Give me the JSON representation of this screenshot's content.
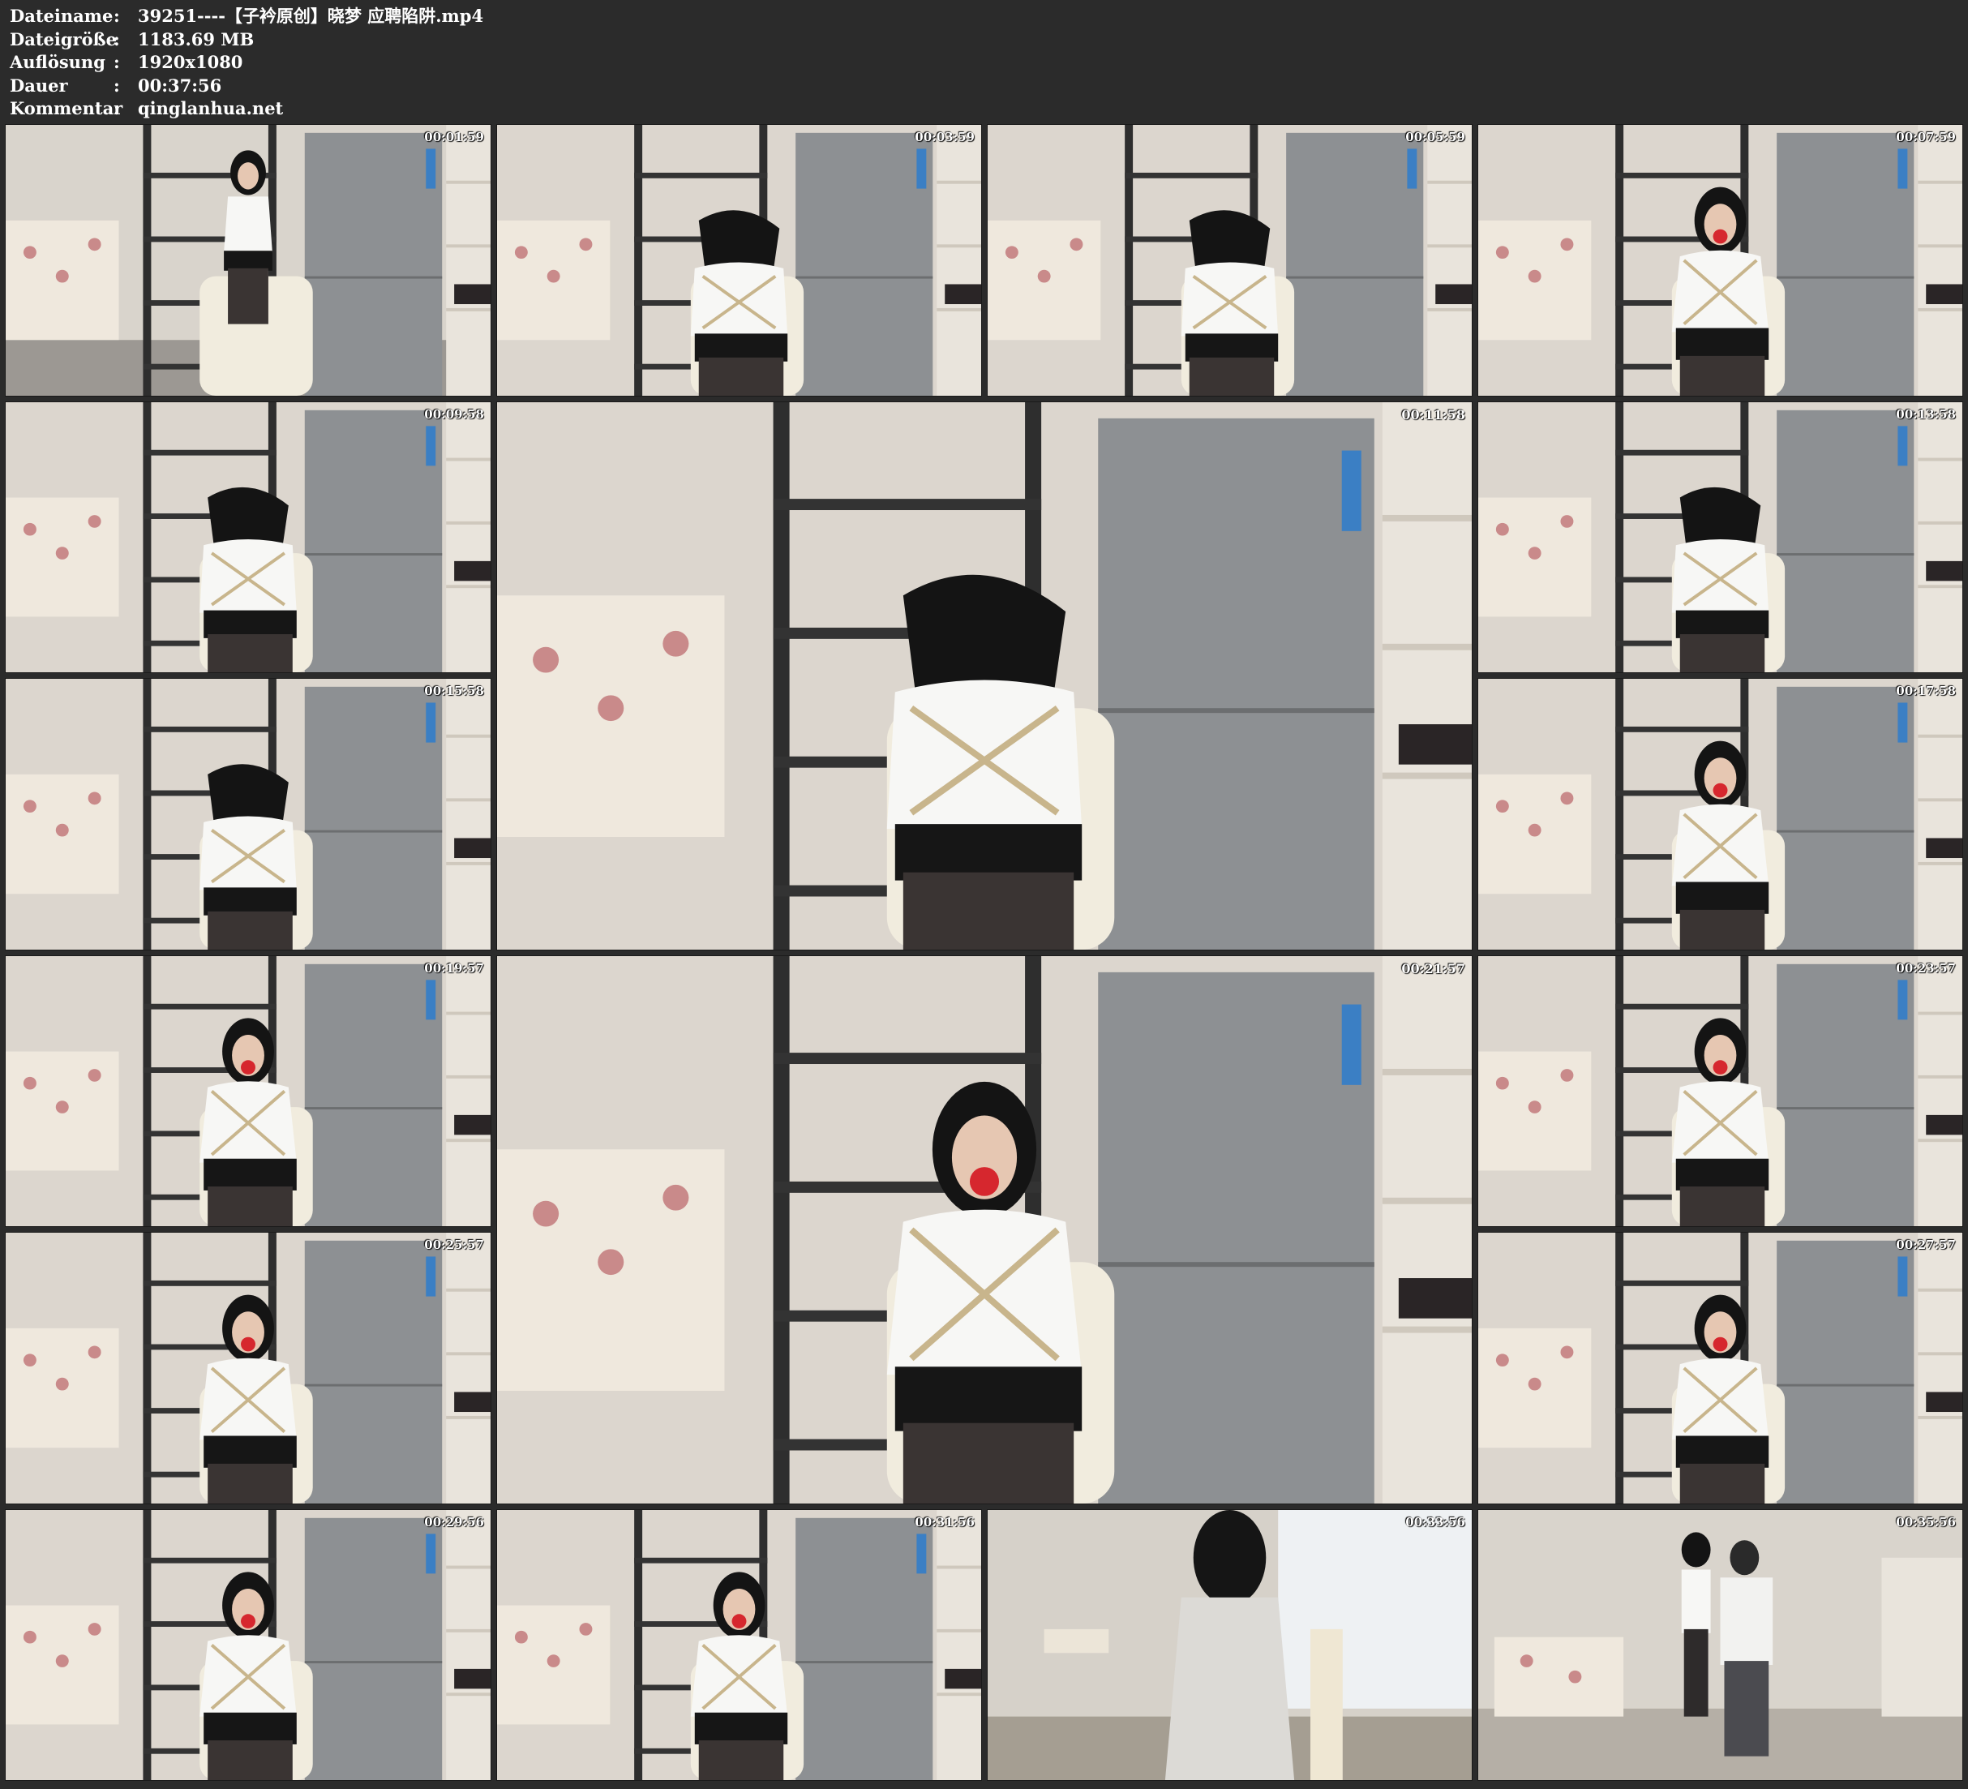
{
  "meta": {
    "file_label": "Dateiname",
    "file_value": "39251----【子衿原创】晓梦 应聘陷阱.mp4",
    "size_label": "Dateigröße",
    "size_value": "1183.69 MB",
    "res_label": "Auflösung",
    "res_value": "1920x1080",
    "dur_label": "Dauer",
    "dur_value": "00:37:56",
    "comment_label": "Kommentar",
    "comment_value": "qinglanhua.net",
    "separator": ":"
  },
  "thumbs": [
    {
      "time": "00:01:59",
      "scene": "wide-seated"
    },
    {
      "time": "00:03:59",
      "scene": "close-bowed"
    },
    {
      "time": "00:05:59",
      "scene": "close-bowed"
    },
    {
      "time": "00:07:59",
      "scene": "close-gag"
    },
    {
      "time": "00:09:58",
      "scene": "close-bowed"
    },
    {
      "time": "00:11:58",
      "scene": "close-bowed"
    },
    {
      "time": "00:13:58",
      "scene": "close-bowed"
    },
    {
      "time": "00:15:58",
      "scene": "close-leaning"
    },
    {
      "time": "00:17:58",
      "scene": "close-gag"
    },
    {
      "time": "00:19:57",
      "scene": "close-gag"
    },
    {
      "time": "00:21:57",
      "scene": "close-gag"
    },
    {
      "time": "00:23:57",
      "scene": "close-gag"
    },
    {
      "time": "00:25:57",
      "scene": "close-gag"
    },
    {
      "time": "00:27:57",
      "scene": "close-gag"
    },
    {
      "time": "00:29:56",
      "scene": "close-gag"
    },
    {
      "time": "00:31:56",
      "scene": "close-gag"
    },
    {
      "time": "00:33:56",
      "scene": "back-view"
    },
    {
      "time": "00:35:56",
      "scene": "wide-two"
    }
  ]
}
